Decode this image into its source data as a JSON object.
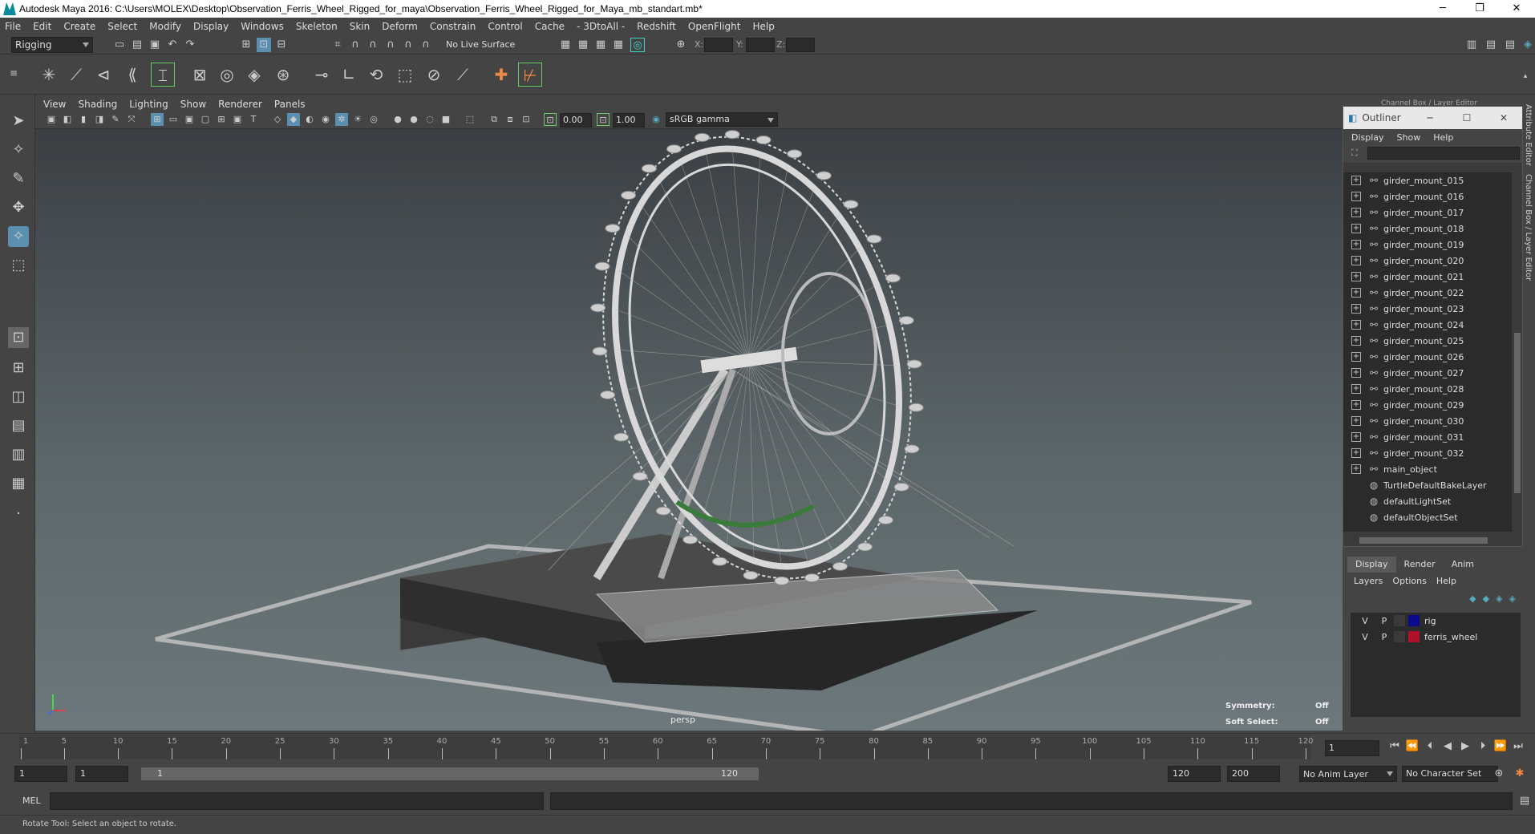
{
  "window": {
    "title": "Autodesk Maya 2016: C:\\Users\\MOLEX\\Desktop\\Observation_Ferris_Wheel_Rigged_for_maya\\Observation_Ferris_Wheel_Rigged_for_Maya_mb_standart.mb*",
    "minimize": "─",
    "restore": "❐",
    "close": "✕"
  },
  "menubar": [
    "File",
    "Edit",
    "Create",
    "Select",
    "Modify",
    "Display",
    "Windows",
    "Skeleton",
    "Skin",
    "Deform",
    "Constrain",
    "Control",
    "Cache",
    "- 3DtoAll -",
    "Redshift",
    "OpenFlight",
    "Help"
  ],
  "statusline": {
    "menuset": "Rigging",
    "live_surface": "No Live Surface",
    "x_label": "X:",
    "y_label": "Y:",
    "z_label": "Z:"
  },
  "viewport": {
    "menu": [
      "View",
      "Shading",
      "Lighting",
      "Show",
      "Renderer",
      "Panels"
    ],
    "exposure": "0.00",
    "gamma": "1.00",
    "color_space": "sRGB gamma",
    "camera": "persp",
    "symmetry_label": "Symmetry:",
    "symmetry_value": "Off",
    "softselect_label": "Soft Select:",
    "softselect_value": "Off"
  },
  "panel_header": "Channel Box / Layer Editor",
  "outliner": {
    "title": "Outliner",
    "menu": [
      "Display",
      "Show",
      "Help"
    ],
    "items": [
      {
        "name": "girder_mount_015",
        "expandable": true
      },
      {
        "name": "girder_mount_016",
        "expandable": true
      },
      {
        "name": "girder_mount_017",
        "expandable": true
      },
      {
        "name": "girder_mount_018",
        "expandable": true
      },
      {
        "name": "girder_mount_019",
        "expandable": true
      },
      {
        "name": "girder_mount_020",
        "expandable": true
      },
      {
        "name": "girder_mount_021",
        "expandable": true
      },
      {
        "name": "girder_mount_022",
        "expandable": true
      },
      {
        "name": "girder_mount_023",
        "expandable": true
      },
      {
        "name": "girder_mount_024",
        "expandable": true
      },
      {
        "name": "girder_mount_025",
        "expandable": true
      },
      {
        "name": "girder_mount_026",
        "expandable": true
      },
      {
        "name": "girder_mount_027",
        "expandable": true
      },
      {
        "name": "girder_mount_028",
        "expandable": true
      },
      {
        "name": "girder_mount_029",
        "expandable": true
      },
      {
        "name": "girder_mount_030",
        "expandable": true
      },
      {
        "name": "girder_mount_031",
        "expandable": true
      },
      {
        "name": "girder_mount_032",
        "expandable": true
      },
      {
        "name": "main_object",
        "expandable": true
      },
      {
        "name": "TurtleDefaultBakeLayer",
        "expandable": false
      },
      {
        "name": "defaultLightSet",
        "expandable": false
      },
      {
        "name": "defaultObjectSet",
        "expandable": false
      }
    ]
  },
  "layer_editor": {
    "tabs": [
      "Display",
      "Render",
      "Anim"
    ],
    "menu": [
      "Layers",
      "Options",
      "Help"
    ],
    "layers": [
      {
        "v": "V",
        "p": "P",
        "name": "rig",
        "color": "#0a0a8a"
      },
      {
        "v": "V",
        "p": "P",
        "name": "ferris_wheel",
        "color": "#b0102a"
      }
    ]
  },
  "side_tabs": [
    "Attribute Editor",
    "Channel Box / Layer Editor"
  ],
  "timeslider": {
    "ticks": [
      1,
      5,
      10,
      15,
      20,
      25,
      30,
      35,
      40,
      45,
      50,
      55,
      60,
      65,
      70,
      75,
      80,
      85,
      90,
      95,
      100,
      105,
      110,
      115,
      120
    ],
    "current_frame": "1",
    "buttons": [
      "⏮",
      "⏪",
      "⏴",
      "◀",
      "▶",
      "⏵",
      "⏩",
      "⏭"
    ]
  },
  "range": {
    "start_outer": "1",
    "start_inner": "1",
    "bar_start": "1",
    "bar_end": "120",
    "end_inner": "120",
    "end_outer": "200",
    "anim_layer": "No Anim Layer",
    "character_set": "No Character Set"
  },
  "cmdline": {
    "label": "MEL"
  },
  "helpline": {
    "text": "Rotate Tool: Select an object to rotate."
  }
}
